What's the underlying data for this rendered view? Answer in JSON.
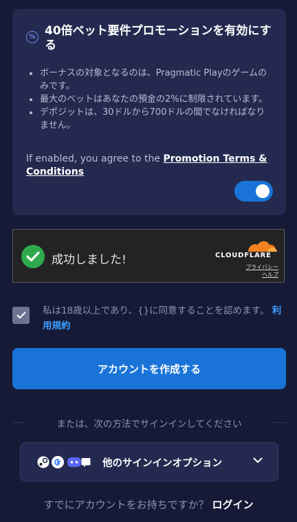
{
  "promo": {
    "icon": "percent-badge-icon",
    "title": "40倍ベット要件プロモーションを有効にする",
    "rules": [
      "ボーナスの対象となるのは、Pragmatic Playのゲームのみです。",
      "最大のベットはあなたの預金の2%に制限されています。",
      "デポジットは、30ドルから700ドルの間でなければなりません。"
    ],
    "terms_prefix": "If enabled, you agree to the ",
    "terms_link": "Promotion Terms & Conditions",
    "toggle_on": true
  },
  "captcha": {
    "status": "成功しました!",
    "brand": "CLOUDFLARE",
    "privacy": "プライバシー",
    "help": "ヘルプ",
    "success_color": "#2eaa4d",
    "brand_color": "#f48120"
  },
  "consent": {
    "checked": true,
    "text": "私は18歳以上であり、{}に同意することを認めます。",
    "link": "利用規約"
  },
  "create_button": "アカウントを作成する",
  "divider_text": "または、次の方法でサインインしてください",
  "signin_options": {
    "label": "他のサインインオプション",
    "provider_icons": [
      "steam-icon",
      "google-icon",
      "discord-icon"
    ]
  },
  "login": {
    "prompt": "すでにアカウントをお持ちですか？",
    "link": "ログイン"
  },
  "colors": {
    "background": "#161a36",
    "card": "#242a4f",
    "accent": "#1a74d8",
    "link": "#3f9dff"
  }
}
